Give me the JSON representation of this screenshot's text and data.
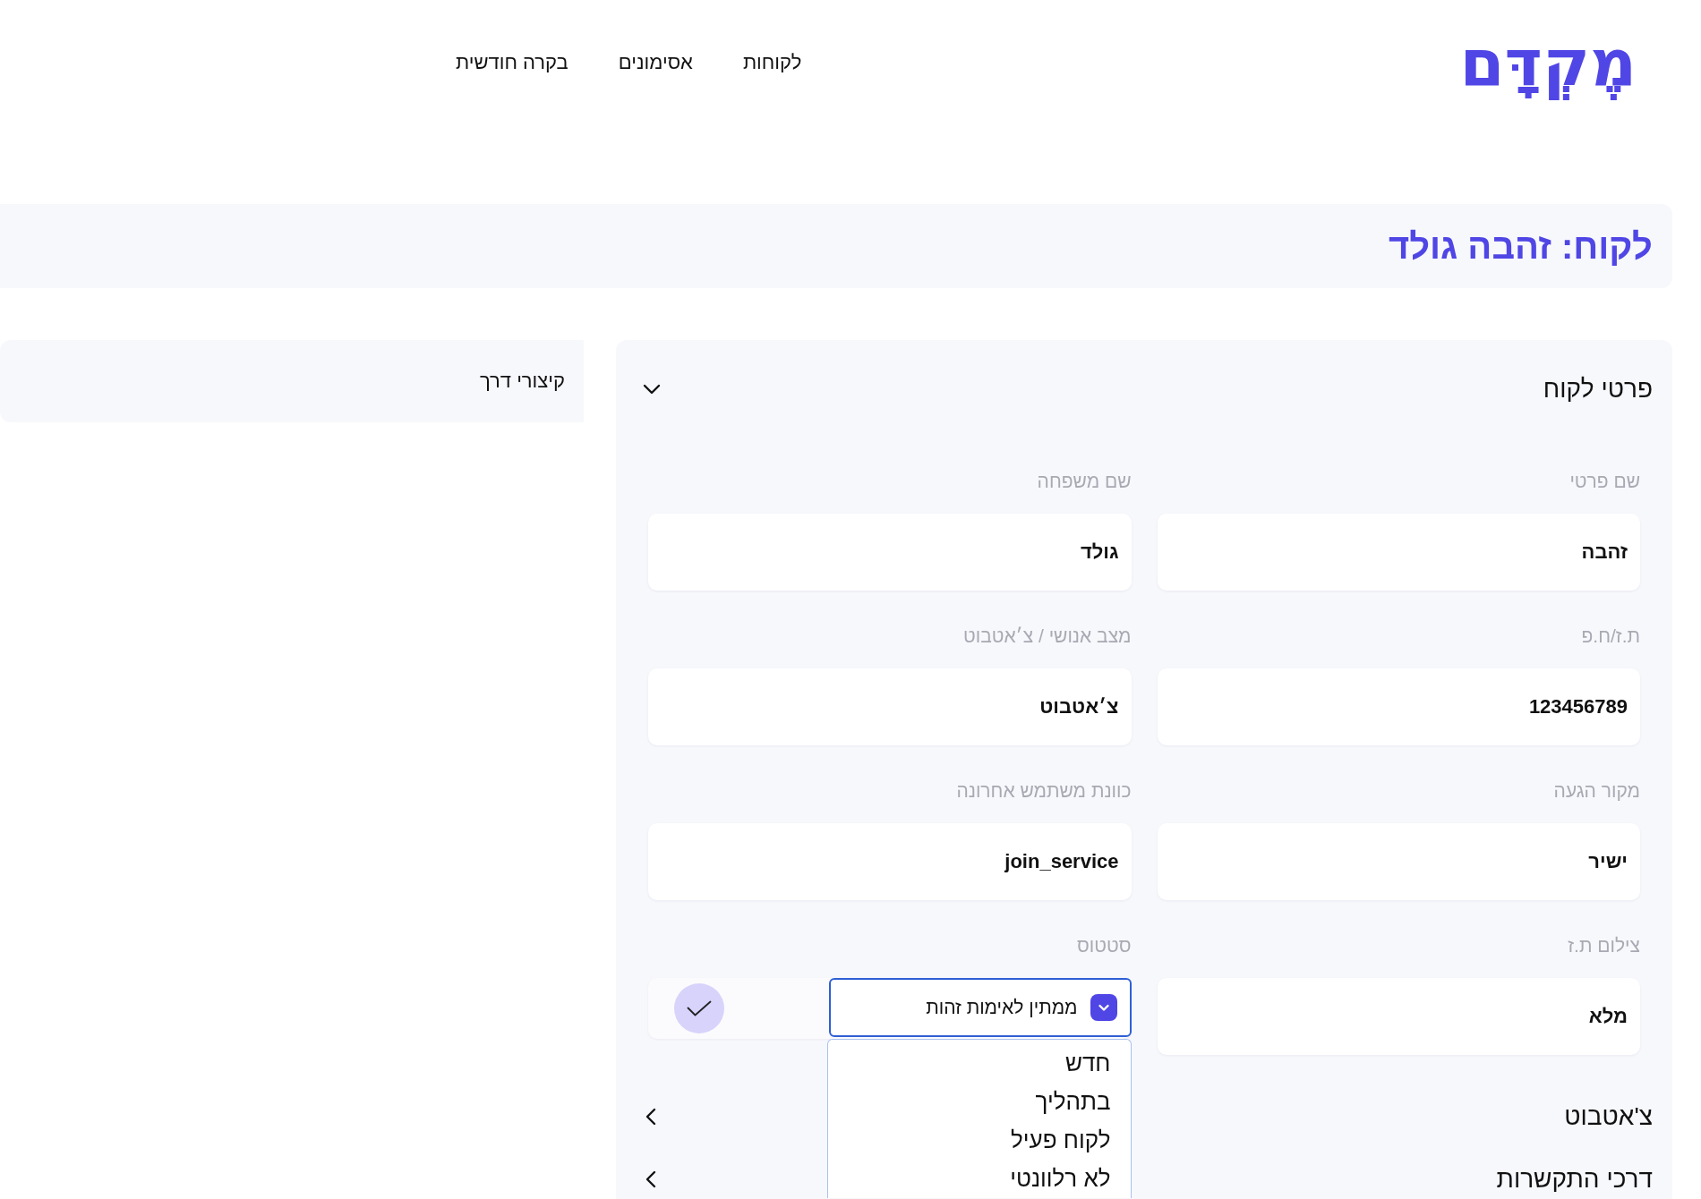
{
  "header": {
    "logo": "מֶקְדָּם",
    "nav": [
      {
        "label": "לקוחות"
      },
      {
        "label": "אסימונים"
      },
      {
        "label": "בקרה חודשית"
      }
    ]
  },
  "title": "לקוח: זהבה גולד",
  "customer_details": {
    "title": "פרטי לקוח",
    "expanded": true,
    "fields": [
      {
        "kind": "text",
        "label": "שם פרטי",
        "value": "זהבה"
      },
      {
        "kind": "text",
        "label": "שם משפחה",
        "value": "גולד"
      },
      {
        "kind": "text",
        "label": "ת.ז/ח.פ",
        "value": "123456789"
      },
      {
        "kind": "text",
        "label": "מצב אנושי / צ׳אטבוט",
        "value": "צ׳אטבוט"
      },
      {
        "kind": "text",
        "label": "מקור הגעה",
        "value": "ישיר"
      },
      {
        "kind": "text",
        "label": "כוונת משתמש אחרונה",
        "value": "join_service"
      },
      {
        "kind": "text",
        "label": "צילום ת.ז",
        "value": "מלא"
      },
      {
        "kind": "select",
        "label": "סטטוס",
        "value": "ממתין לאימות זהות",
        "open": true,
        "options": [
          {
            "label": "חדש",
            "selected": false
          },
          {
            "label": "בתהליך",
            "selected": false
          },
          {
            "label": "לקוח פעיל",
            "selected": false
          },
          {
            "label": "לא רלוונטי",
            "selected": false
          }
        ]
      }
    ]
  },
  "sections": [
    {
      "title": "צ'אטבוט",
      "expanded": false
    },
    {
      "title": "דרכי התקשרות",
      "expanded": false
    }
  ],
  "shortcuts": {
    "title": "קיצורי דרך"
  }
}
